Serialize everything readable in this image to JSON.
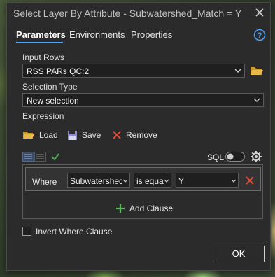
{
  "window": {
    "title": "Select Layer By Attribute - Subwatershed_Match = Y"
  },
  "tabs": [
    {
      "label": "Parameters",
      "active": true
    },
    {
      "label": "Environments",
      "active": false
    },
    {
      "label": "Properties",
      "active": false
    }
  ],
  "params": {
    "input_rows_label": "Input Rows",
    "input_rows_value": "RSS PARs QC:2",
    "selection_type_label": "Selection Type",
    "selection_type_value": "New selection",
    "expression_label": "Expression"
  },
  "expression_toolbar": {
    "load_label": "Load",
    "save_label": "Save",
    "remove_label": "Remove",
    "sql_label": "SQL",
    "sql_toggle_on": false
  },
  "clause": {
    "where_label": "Where",
    "field_value": "Subwatershed_Match",
    "operator_value": "is equal to",
    "value": "Y"
  },
  "add_clause_label": "Add Clause",
  "invert_where_label": "Invert Where Clause",
  "invert_where_checked": false,
  "ok_label": "OK",
  "colors": {
    "accent": "#4aa3ff",
    "folder": "#e8b84a",
    "remove": "#e04a3a",
    "add": "#5cb85c",
    "check": "#4caf50"
  },
  "icons": [
    "close-icon",
    "help-icon",
    "folder-icon",
    "chevron-down-icon",
    "save-icon",
    "remove-icon",
    "check-icon",
    "gear-icon",
    "add-icon"
  ]
}
